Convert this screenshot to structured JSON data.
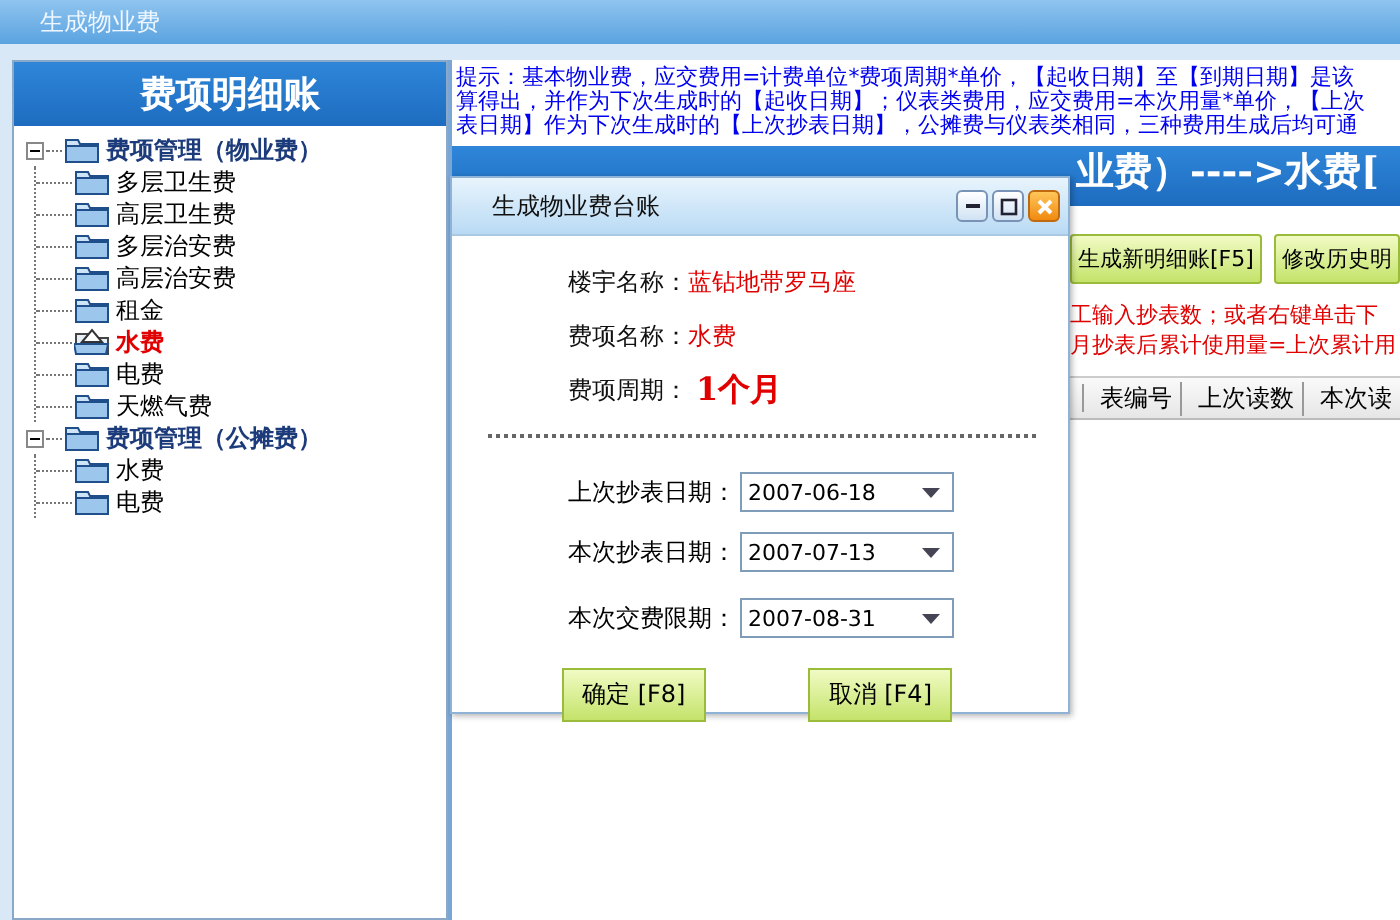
{
  "window": {
    "title": "生成物业费"
  },
  "sidebar": {
    "title": "费项明细账",
    "tree": [
      {
        "label": "费项管理（物业费）",
        "expanded": true,
        "selected": false,
        "children": [
          {
            "label": "多层卫生费",
            "selected": false
          },
          {
            "label": "高层卫生费",
            "selected": false
          },
          {
            "label": "多层治安费",
            "selected": false
          },
          {
            "label": "高层治安费",
            "selected": false
          },
          {
            "label": "租金",
            "selected": false
          },
          {
            "label": "水费",
            "selected": true
          },
          {
            "label": "电费",
            "selected": false
          },
          {
            "label": "天燃气费",
            "selected": false
          }
        ]
      },
      {
        "label": "费项管理（公摊费）",
        "expanded": true,
        "selected": false,
        "children": [
          {
            "label": "水费",
            "selected": false
          },
          {
            "label": "电费",
            "selected": false
          }
        ]
      }
    ]
  },
  "hint_lines": [
    "提示：基本物业费，应交费用=计费单位*费项周期*单价，【起收日期】至【到期日期】是该",
    "算得出，并作为下次生成时的【起收日期】；仪表类费用，应交费用=本次用量*单价，【上次",
    "表日期】作为下次生成时的【上次抄表日期】，公摊费与仪表类相同，三种费用生成后均可通"
  ],
  "header_bar": "业费）---->水费[",
  "toolbar_buttons": [
    "生成新明细账[F5]",
    "修改历史明"
  ],
  "notes": [
    "工输入抄表数；或者右键单击下",
    "月抄表后累计使用量=上次累计用"
  ],
  "table": {
    "columns": [
      "表编号",
      "上次读数",
      "本次读"
    ]
  },
  "dialog": {
    "title": "生成物业费台账",
    "info": [
      {
        "label": "楼宇名称：",
        "value": "蓝钻地带罗马座",
        "kind": "normal"
      },
      {
        "label": "费项名称：",
        "value": "水费",
        "kind": "normal"
      },
      {
        "label": "费项周期：",
        "value": "1个月",
        "kind": "large"
      }
    ],
    "dates": [
      {
        "label": "上次抄表日期：",
        "value": "2007-06-18"
      },
      {
        "label": "本次抄表日期：",
        "value": "2007-07-13"
      },
      {
        "label": "本次交费限期：",
        "value": "2007-08-31"
      }
    ],
    "buttons": [
      "确定 [F8]",
      "取消 [F4]"
    ]
  }
}
